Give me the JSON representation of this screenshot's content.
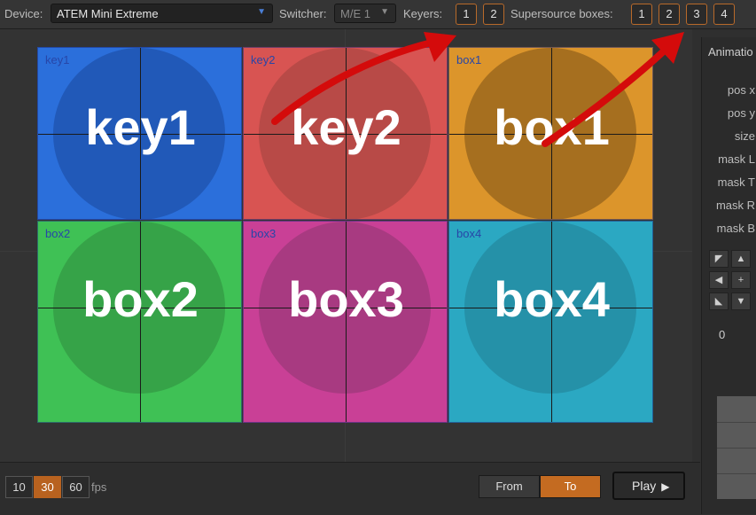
{
  "toolbar": {
    "device_label": "Device:",
    "device_value": "ATEM Mini Extreme",
    "switcher_label": "Switcher:",
    "switcher_value": "M/E 1",
    "keyers_label": "Keyers:",
    "keyer_buttons": [
      "1",
      "2"
    ],
    "supersource_label": "Supersource boxes:",
    "supersource_buttons": [
      "1",
      "2",
      "3",
      "4"
    ]
  },
  "preview": {
    "cells": [
      {
        "small": "key1",
        "big": "key1",
        "bg": "#2b6fdb",
        "circle": "#2159b8"
      },
      {
        "small": "key2",
        "big": "key2",
        "bg": "#d85452",
        "circle": "#b84a47"
      },
      {
        "small": "box1",
        "big": "box1",
        "bg": "#dc952b",
        "circle": "#a66f1f"
      },
      {
        "small": "box2",
        "big": "box2",
        "bg": "#3fc155",
        "circle": "#36a348"
      },
      {
        "small": "box3",
        "big": "box3",
        "bg": "#c94096",
        "circle": "#a83a81"
      },
      {
        "small": "box4",
        "big": "box4",
        "bg": "#2ba8c2",
        "circle": "#2591a8"
      }
    ]
  },
  "panel": {
    "title": "Animatio",
    "rows": [
      "pos x",
      "pos y",
      "size",
      "mask L",
      "mask T",
      "mask R",
      "mask B"
    ],
    "value": "0",
    "arrow_glyphs": [
      "◤",
      "▲",
      "◀",
      "+",
      "◣",
      "▼"
    ]
  },
  "bottom": {
    "fps_options": [
      "10",
      "30",
      "60"
    ],
    "fps_selected": "30",
    "fps_label": "fps",
    "from_label": "From",
    "to_label": "To",
    "play_label": "Play",
    "play_icon": "▶"
  },
  "annotation": {
    "arrow_color": "#d40b0b"
  }
}
